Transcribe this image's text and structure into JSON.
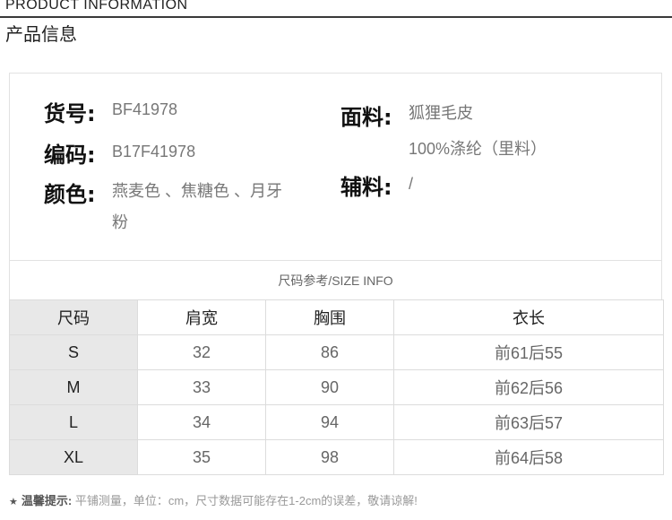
{
  "header": {
    "title_en": "PRODUCT INFORMATION",
    "title_cn": "产品信息"
  },
  "info": {
    "item_no_label": "货号:",
    "item_no": "BF41978",
    "code_label": "编码:",
    "code": "B17F41978",
    "color_label": "颜色:",
    "color_line1": "燕麦色 、焦糖色 、月牙",
    "color_line2": "粉",
    "fabric_label": "面料:",
    "fabric_line1": "狐狸毛皮",
    "fabric_line2": "100%涤纶（里料）",
    "accessory_label": "辅料:",
    "accessory": "/"
  },
  "size_table": {
    "caption": "尺码参考/SIZE INFO",
    "headers": [
      "尺码",
      "肩宽",
      "胸围",
      "衣长"
    ],
    "rows": [
      [
        "S",
        "32",
        "86",
        "前61后55"
      ],
      [
        "M",
        "33",
        "90",
        "前62后56"
      ],
      [
        "L",
        "34",
        "94",
        "前63后57"
      ],
      [
        "XL",
        "35",
        "98",
        "前64后58"
      ]
    ]
  },
  "tip": {
    "icon": "star-icon",
    "label": "温馨提示:",
    "text": "平铺测量，单位：cm，尺寸数据可能存在1-2cm的误差，敬请谅解!"
  }
}
